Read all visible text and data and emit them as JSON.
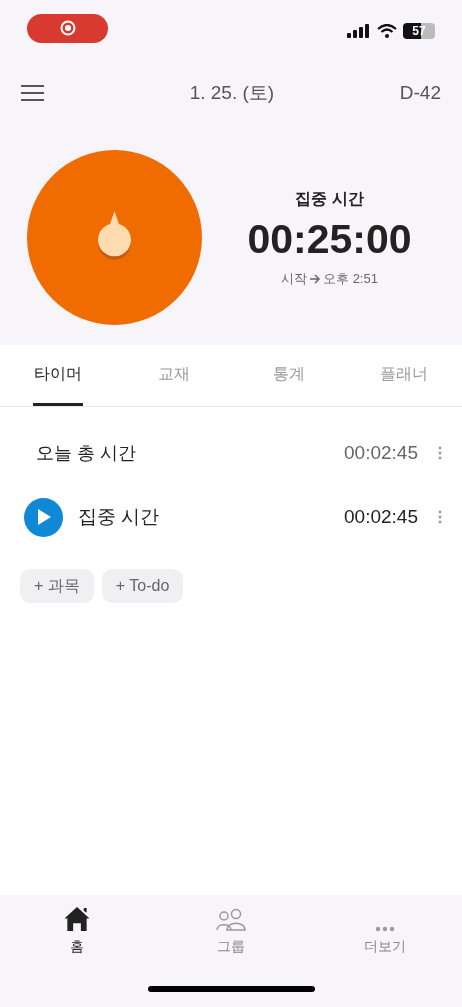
{
  "status_bar": {
    "battery": "57"
  },
  "header": {
    "date": "1. 25. (토)",
    "dday": "D-42"
  },
  "timer": {
    "title": "집중 시간",
    "time": "00:25:00",
    "start_label": "시작",
    "start_time": "오후 2:51"
  },
  "tabs": [
    {
      "label": "타이머",
      "selected": true
    },
    {
      "label": "교재",
      "selected": false
    },
    {
      "label": "통계",
      "selected": false
    },
    {
      "label": "플래너",
      "selected": false
    }
  ],
  "total": {
    "label": "오늘 총 시간",
    "time": "00:02:45"
  },
  "subjects": [
    {
      "name": "집중 시간",
      "time": "00:02:45",
      "color": "#0f89d6"
    }
  ],
  "add_buttons": [
    "+ 과목",
    "+ To-do"
  ],
  "bottom_nav": [
    {
      "label": "홈",
      "kind": "home",
      "selected": true
    },
    {
      "label": "그룹",
      "kind": "group",
      "selected": false
    },
    {
      "label": "더보기",
      "kind": "more",
      "selected": false
    }
  ]
}
